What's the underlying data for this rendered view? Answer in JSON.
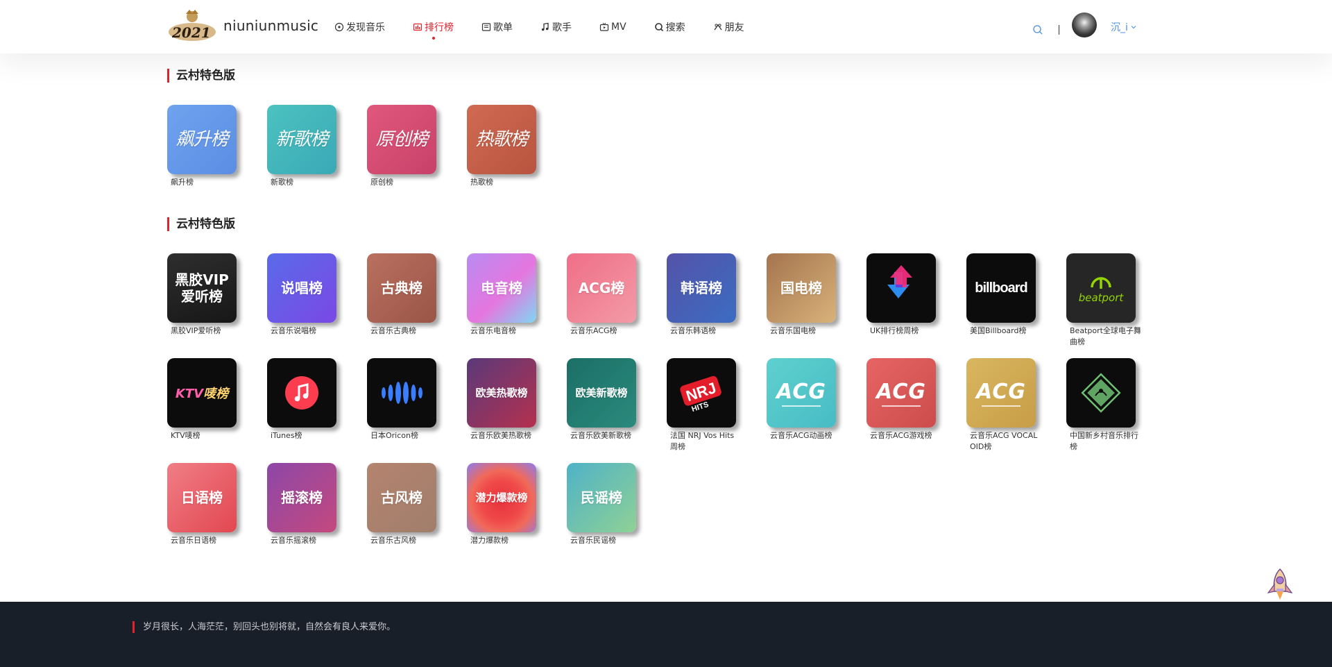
{
  "header": {
    "logo_text": "niuniunmusic",
    "logo_year": "2021",
    "nav": [
      {
        "label": "发现音乐",
        "icon": "disc-icon",
        "active": false
      },
      {
        "label": "排行榜",
        "icon": "chart-icon",
        "active": true
      },
      {
        "label": "歌单",
        "icon": "playlist-icon",
        "active": false
      },
      {
        "label": "歌手",
        "icon": "music-note-icon",
        "active": false
      },
      {
        "label": "MV",
        "icon": "tv-icon",
        "active": false
      },
      {
        "label": "搜索",
        "icon": "search-icon",
        "active": false
      },
      {
        "label": "朋友",
        "icon": "friends-icon",
        "active": false
      }
    ],
    "username": "沉_i"
  },
  "sections": [
    {
      "title": "云村特色版",
      "items": [
        {
          "tile": "飙升榜",
          "label": "飙升榜",
          "style": "hand",
          "bg": "linear-gradient(135deg,#6fa3ef 0%,#5b8de3 100%)"
        },
        {
          "tile": "新歌榜",
          "label": "新歌榜",
          "style": "hand",
          "bg": "linear-gradient(135deg,#4cc2c0 0%,#3aa9b6 100%)"
        },
        {
          "tile": "原创榜",
          "label": "原创榜",
          "style": "hand",
          "bg": "linear-gradient(135deg,#e0587c 0%,#c84168 100%)"
        },
        {
          "tile": "热歌榜",
          "label": "热歌榜",
          "style": "hand",
          "bg": "linear-gradient(135deg,#d06a52 0%,#b8543f 100%)"
        }
      ]
    },
    {
      "title": "云村特色版",
      "items": [
        {
          "tile": "黑胶VIP\n爱听榜",
          "label": "黑胶VIP爱听榜",
          "style": "plain",
          "bg": "linear-gradient(160deg,#2e2e2e 0%,#171717 100%)"
        },
        {
          "tile": "说唱榜",
          "label": "云音乐说唱榜",
          "style": "plain",
          "bg": "linear-gradient(135deg,#5a6be8 0%,#7a48e6 100%)"
        },
        {
          "tile": "古典榜",
          "label": "云音乐古典榜",
          "style": "plain",
          "bg": "linear-gradient(135deg,#b9705f 0%,#9a5547 100%)"
        },
        {
          "tile": "电音榜",
          "label": "云音乐电音榜",
          "style": "plain",
          "bg": "linear-gradient(135deg,#b88cf2 0%,#e576df 55%,#7fd7f2 100%)"
        },
        {
          "tile": "ACG榜",
          "label": "云音乐ACG榜",
          "style": "plain",
          "bg": "linear-gradient(135deg,#ef6e88 0%,#f39aa6 100%)"
        },
        {
          "tile": "韩语榜",
          "label": "云音乐韩语榜",
          "style": "plain",
          "bg": "linear-gradient(135deg,#5453a8 0%,#3b6cc2 100%)"
        },
        {
          "tile": "国电榜",
          "label": "云音乐国电榜",
          "style": "plain",
          "bg": "linear-gradient(135deg,#a5744e 0%,#d8b27a 100%)"
        },
        {
          "tile": "",
          "label": "UK排行榜周榜",
          "style": "uk",
          "bg": "#0c0c0c"
        },
        {
          "tile": "billboard",
          "label": "美国Billboard榜",
          "style": "billboard",
          "bg": "#0c0c0c"
        },
        {
          "tile": "beatport",
          "label": "Beatport全球电子舞曲榜",
          "style": "beatport",
          "bg": "#262626"
        },
        {
          "tile": "KTV唛榜",
          "label": "KTV唛榜",
          "style": "ktv",
          "bg": "#0c0c0c"
        },
        {
          "tile": "",
          "label": "iTunes榜",
          "style": "itunes",
          "bg": "#0c0c0c"
        },
        {
          "tile": "",
          "label": "日本Oricon榜",
          "style": "oricon",
          "bg": "#0c0c0c"
        },
        {
          "tile": "欧美热歌榜",
          "label": "云音乐欧美热歌榜",
          "style": "small",
          "bg": "linear-gradient(135deg,#5a3a7a 0%,#b5304e 100%)"
        },
        {
          "tile": "欧美新歌榜",
          "label": "云音乐欧美新歌榜",
          "style": "small",
          "bg": "linear-gradient(135deg,#1c6f66 0%,#2a8a7c 100%)"
        },
        {
          "tile": "NRJ",
          "label": "法国 NRJ Vos Hits 周榜",
          "style": "nrj",
          "bg": "#0c0c0c"
        },
        {
          "tile": "ACG",
          "label": "云音乐ACG动画榜",
          "style": "acg",
          "bg": "linear-gradient(135deg,#5fd0cf 0%,#47bcc4 100%)"
        },
        {
          "tile": "ACG",
          "label": "云音乐ACG游戏榜",
          "style": "acg",
          "bg": "linear-gradient(135deg,#e66464 0%,#cc4c4c 100%)"
        },
        {
          "tile": "ACG",
          "label": "云音乐ACG VOCALOID榜",
          "style": "acg",
          "bg": "linear-gradient(135deg,#d9b660 0%,#c89d47 100%)"
        },
        {
          "tile": "",
          "label": "中国新乡村音乐排行榜",
          "style": "country",
          "bg": "#0c0c0c"
        },
        {
          "tile": "日语榜",
          "label": "云音乐日语榜",
          "style": "plain",
          "bg": "linear-gradient(135deg,#f07e86 0%,#e24750 100%)"
        },
        {
          "tile": "摇滚榜",
          "label": "云音乐摇滚榜",
          "style": "plain",
          "bg": "linear-gradient(135deg,#8d47a8 0%,#c4497e 100%)"
        },
        {
          "tile": "古风榜",
          "label": "云音乐古风榜",
          "style": "plain",
          "bg": "linear-gradient(135deg,#b4846e 0%,#a07e6c 100%)"
        },
        {
          "tile": "潜力爆款榜",
          "label": "潜力爆款榜",
          "style": "small",
          "bg": "radial-gradient(circle at 50% 55%,#e6323c 0%,#f04a4a 40%,#f06a5a 60%,#8a7cf0 100%)"
        },
        {
          "tile": "民谣榜",
          "label": "云音乐民谣榜",
          "style": "plain",
          "bg": "linear-gradient(135deg,#4fb2c7 0%,#8fd196 100%)"
        }
      ]
    }
  ],
  "footer": {
    "quote": "岁月很长，人海茫茫，别回头也别将就，自然会有良人来爱你。"
  },
  "colors": {
    "accent": "#e5212b",
    "link": "#4a90e2",
    "footer_bg": "#191f28"
  }
}
